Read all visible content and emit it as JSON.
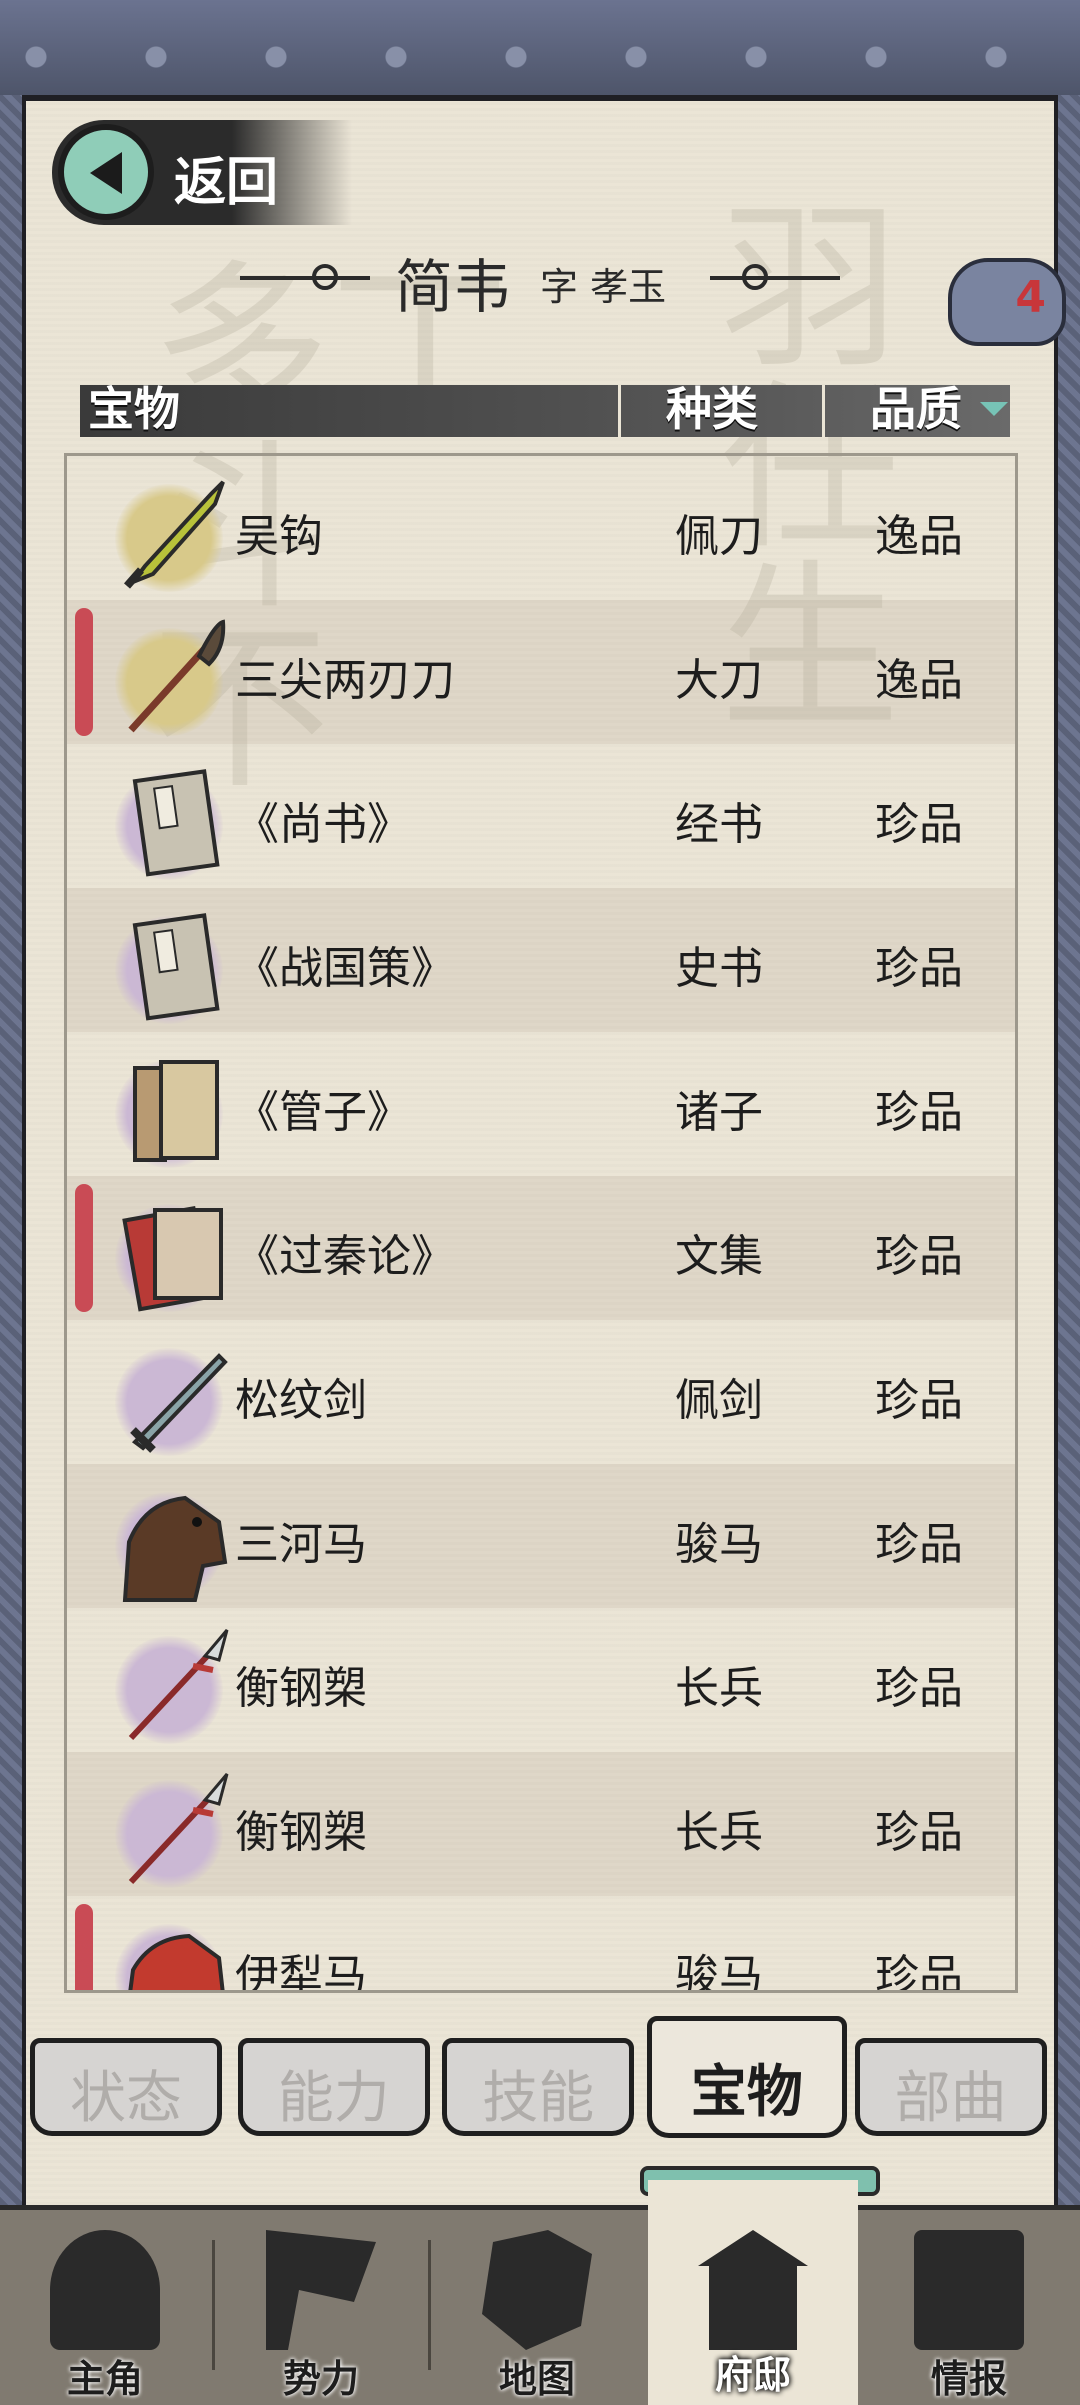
{
  "header": {
    "back_label": "返回",
    "character_name": "简韦",
    "courtesy_name": "字 孝玉",
    "badge_count": "4"
  },
  "table": {
    "columns": {
      "item": "宝物",
      "kind": "种类",
      "quality": "品质"
    },
    "rows": [
      {
        "name": "吴钩",
        "kind": "佩刀",
        "quality": "逸品",
        "icon": "blade-icon",
        "halo": "#d8c98a",
        "marked": false
      },
      {
        "name": "三尖两刃刀",
        "kind": "大刀",
        "quality": "逸品",
        "icon": "glaive-icon",
        "halo": "#d8c98a",
        "marked": true
      },
      {
        "name": "《尚书》",
        "kind": "经书",
        "quality": "珍品",
        "icon": "book-icon",
        "halo": "#cbb8d4",
        "marked": false
      },
      {
        "name": "《战国策》",
        "kind": "史书",
        "quality": "珍品",
        "icon": "book-icon",
        "halo": "#cbb8d4",
        "marked": false
      },
      {
        "name": "《管子》",
        "kind": "诸子",
        "quality": "珍品",
        "icon": "books-icon",
        "halo": "#cbb8d4",
        "marked": false
      },
      {
        "name": "《过秦论》",
        "kind": "文集",
        "quality": "珍品",
        "icon": "red-books-icon",
        "halo": "#cbb8d4",
        "marked": true
      },
      {
        "name": "松纹剑",
        "kind": "佩剑",
        "quality": "珍品",
        "icon": "sword-icon",
        "halo": "#cbb8d4",
        "marked": false
      },
      {
        "name": "三河马",
        "kind": "骏马",
        "quality": "珍品",
        "icon": "horse-icon",
        "halo": "#cbb8d4",
        "marked": false
      },
      {
        "name": "衡钢槊",
        "kind": "长兵",
        "quality": "珍品",
        "icon": "spear-icon",
        "halo": "#cbb8d4",
        "marked": false
      },
      {
        "name": "衡钢槊",
        "kind": "长兵",
        "quality": "珍品",
        "icon": "spear-icon",
        "halo": "#cbb8d4",
        "marked": false
      },
      {
        "name": "伊犁马",
        "kind": "骏马",
        "quality": "珍品",
        "icon": "red-horse-icon",
        "halo": "#cbb8d4",
        "marked": true
      }
    ]
  },
  "tabs": [
    "状态",
    "能力",
    "技能",
    "宝物",
    "部曲"
  ],
  "active_tab": "宝物",
  "nav": [
    "主角",
    "势力",
    "地图",
    "府邸",
    "情报"
  ],
  "active_nav": "府邸",
  "colors": {
    "paper": "#ebe5d6",
    "accent_teal": "#8fcdb8",
    "mark_red": "#c94b55"
  }
}
